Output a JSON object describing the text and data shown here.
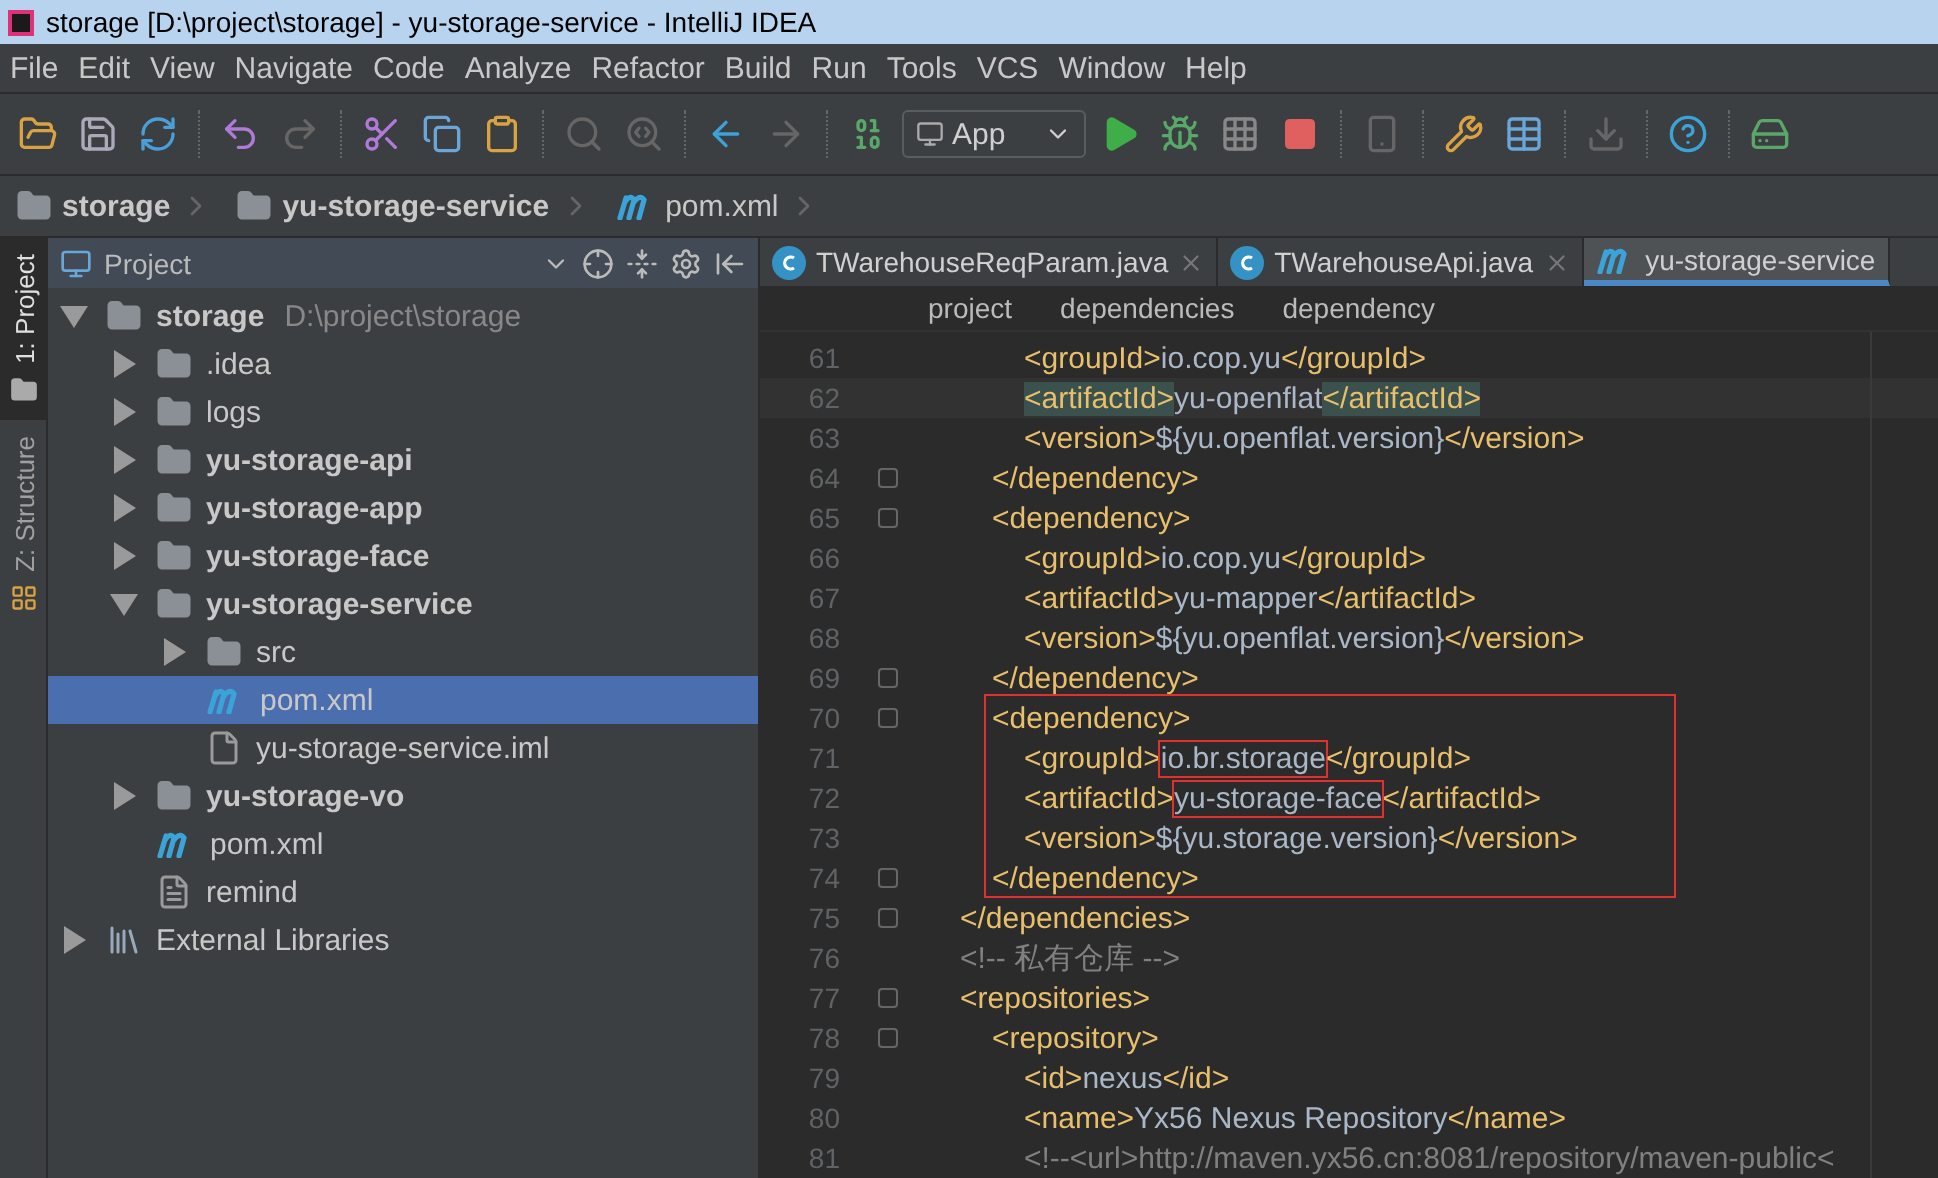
{
  "window": {
    "title": "storage [D:\\project\\storage] - yu-storage-service - IntelliJ IDEA"
  },
  "menu": [
    "File",
    "Edit",
    "View",
    "Navigate",
    "Code",
    "Analyze",
    "Refactor",
    "Build",
    "Run",
    "Tools",
    "VCS",
    "Window",
    "Help"
  ],
  "toolbar": {
    "run_config": "App"
  },
  "nav_path": [
    {
      "label": "storage",
      "kind": "module"
    },
    {
      "label": "yu-storage-service",
      "kind": "module"
    },
    {
      "label": "pom.xml",
      "kind": "maven"
    }
  ],
  "tool_tabs": [
    {
      "label": "1: Project",
      "kind": "project",
      "selected": true
    },
    {
      "label": "Z: Structure",
      "kind": "structure",
      "selected": false
    }
  ],
  "project_panel": {
    "title": "Project",
    "tree": [
      {
        "label": "storage",
        "hint": "D:\\project\\storage",
        "kind": "module",
        "expanded": true,
        "selected": false,
        "children": [
          {
            "label": ".idea",
            "kind": "folder",
            "expanded": false,
            "selected": false
          },
          {
            "label": "logs",
            "kind": "folder",
            "expanded": false,
            "selected": false
          },
          {
            "label": "yu-storage-api",
            "kind": "module",
            "expanded": false,
            "selected": false
          },
          {
            "label": "yu-storage-app",
            "kind": "module",
            "expanded": false,
            "selected": false
          },
          {
            "label": "yu-storage-face",
            "kind": "module",
            "expanded": false,
            "selected": false
          },
          {
            "label": "yu-storage-service",
            "kind": "module",
            "expanded": true,
            "selected": false,
            "children": [
              {
                "label": "src",
                "kind": "folder",
                "expanded": false,
                "selected": false
              },
              {
                "label": "pom.xml",
                "kind": "maven",
                "selected": true
              },
              {
                "label": "yu-storage-service.iml",
                "kind": "iml",
                "selected": false
              }
            ]
          },
          {
            "label": "yu-storage-vo",
            "kind": "module",
            "expanded": false,
            "selected": false
          },
          {
            "label": "pom.xml",
            "kind": "maven",
            "selected": false
          },
          {
            "label": "remind",
            "kind": "text",
            "selected": false
          }
        ]
      },
      {
        "label": "External Libraries",
        "kind": "libraries",
        "expanded": false,
        "selected": false
      }
    ]
  },
  "editor": {
    "tabs": [
      {
        "label": "TWarehouseReqParam.java",
        "kind": "class",
        "selected": false
      },
      {
        "label": "TWarehouseApi.java",
        "kind": "class",
        "selected": false
      },
      {
        "label": "yu-storage-service",
        "kind": "maven",
        "selected": true
      }
    ],
    "breadcrumb": [
      "project",
      "dependencies",
      "dependency"
    ],
    "lines": [
      {
        "number": "61",
        "segments": [
          {
            "kind": "tag",
            "text": "<groupId>"
          },
          {
            "kind": "text",
            "text": "io.cop.yu"
          },
          {
            "kind": "tag",
            "text": "</groupId>"
          }
        ]
      },
      {
        "number": "62",
        "current": true,
        "segments": [
          {
            "kind": "matched",
            "text": "<artifactId>"
          },
          {
            "kind": "text",
            "text": "yu-openflat"
          },
          {
            "kind": "matched",
            "text": "</artifactId>"
          }
        ]
      },
      {
        "number": "63",
        "segments": [
          {
            "kind": "tag",
            "text": "<version>"
          },
          {
            "kind": "text",
            "text": "${yu.openflat.version}"
          },
          {
            "kind": "tag",
            "text": "</version>"
          }
        ]
      },
      {
        "number": "64",
        "fold": true,
        "segments": [
          {
            "kind": "tag",
            "text": "</dependency>"
          }
        ]
      },
      {
        "number": "65",
        "fold": true,
        "segments": [
          {
            "kind": "tag",
            "text": "<dependency>"
          }
        ]
      },
      {
        "number": "66",
        "segments": [
          {
            "kind": "tag",
            "text": "<groupId>"
          },
          {
            "kind": "text",
            "text": "io.cop.yu"
          },
          {
            "kind": "tag",
            "text": "</groupId>"
          }
        ]
      },
      {
        "number": "67",
        "segments": [
          {
            "kind": "tag",
            "text": "<artifactId>"
          },
          {
            "kind": "text",
            "text": "yu-mapper"
          },
          {
            "kind": "tag",
            "text": "</artifactId>"
          }
        ]
      },
      {
        "number": "68",
        "segments": [
          {
            "kind": "tag",
            "text": "<version>"
          },
          {
            "kind": "text",
            "text": "${yu.openflat.version}"
          },
          {
            "kind": "tag",
            "text": "</version>"
          }
        ]
      },
      {
        "number": "69",
        "fold": true,
        "segments": [
          {
            "kind": "tag",
            "text": "</dependency>"
          }
        ]
      },
      {
        "number": "70",
        "fold": true,
        "boxed": true,
        "segments": [
          {
            "kind": "tag",
            "text": "<dependency>"
          }
        ]
      },
      {
        "number": "71",
        "boxed": true,
        "segments": [
          {
            "kind": "tag",
            "text": "<groupId>"
          },
          {
            "kind": "text",
            "text": "io.br.storage",
            "boxed": true
          },
          {
            "kind": "tag",
            "text": "</groupId>"
          }
        ]
      },
      {
        "number": "72",
        "boxed": true,
        "segments": [
          {
            "kind": "tag",
            "text": "<artifactId>"
          },
          {
            "kind": "text",
            "text": "yu-storage-face",
            "boxed": true
          },
          {
            "kind": "tag",
            "text": "</artifactId>"
          }
        ]
      },
      {
        "number": "73",
        "boxed": true,
        "segments": [
          {
            "kind": "tag",
            "text": "<version>"
          },
          {
            "kind": "text",
            "text": "${yu.storage.version}"
          },
          {
            "kind": "tag",
            "text": "</version>"
          }
        ]
      },
      {
        "number": "74",
        "fold": true,
        "boxed": true,
        "segments": [
          {
            "kind": "tag",
            "text": "</dependency>"
          }
        ]
      },
      {
        "number": "75",
        "fold": true,
        "segments": [
          {
            "kind": "tag",
            "text": "</dependencies>"
          }
        ]
      },
      {
        "number": "76",
        "segments": [
          {
            "kind": "comment",
            "text": "<!-- 私有仓库 -->"
          }
        ]
      },
      {
        "number": "77",
        "fold": true,
        "segments": [
          {
            "kind": "tag",
            "text": "<repositories>"
          }
        ]
      },
      {
        "number": "78",
        "fold": true,
        "segments": [
          {
            "kind": "tag",
            "text": "<repository>"
          }
        ]
      },
      {
        "number": "79",
        "segments": [
          {
            "kind": "tag",
            "text": "<id>"
          },
          {
            "kind": "text",
            "text": "nexus"
          },
          {
            "kind": "tag",
            "text": "</id>"
          }
        ]
      },
      {
        "number": "80",
        "segments": [
          {
            "kind": "tag",
            "text": "<name>"
          },
          {
            "kind": "text",
            "text": "Yx56 Nexus Repository"
          },
          {
            "kind": "tag",
            "text": "</name>"
          }
        ]
      },
      {
        "number": "81",
        "segments": [
          {
            "kind": "comment",
            "text": "<!--<url>http://maven.yx56.cn:8081/repository/maven-public<"
          }
        ]
      }
    ]
  }
}
